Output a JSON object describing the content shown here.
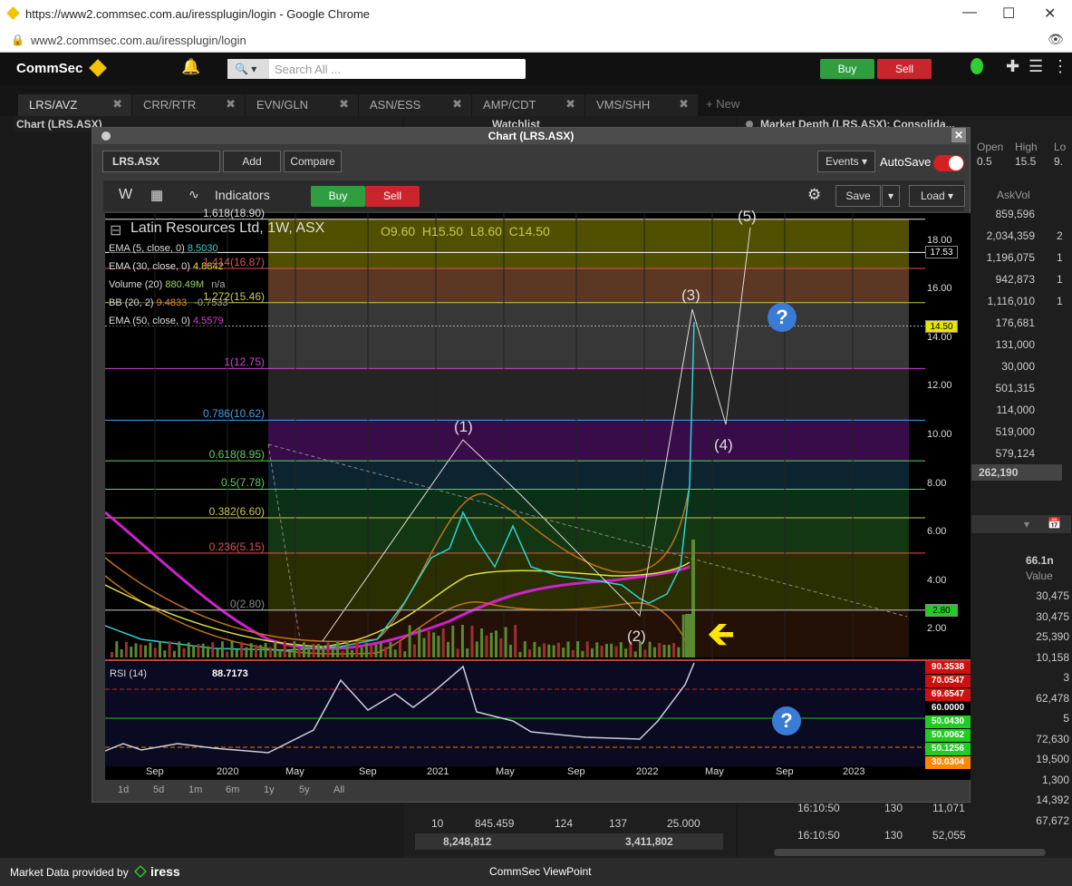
{
  "browser": {
    "title": "https://www2.commsec.com.au/iressplugin/login - Google Chrome",
    "url": "www2.commsec.com.au/iressplugin/login"
  },
  "app": {
    "logo": "CommSec",
    "search_placeholder": "Search All ...",
    "buy": "Buy",
    "sell": "Sell"
  },
  "tabs": [
    "LRS/AVZ",
    "CRR/RTR",
    "EVN/GLN",
    "ASN/ESS",
    "AMP/CDT",
    "VMS/SHH"
  ],
  "new_tab": "+ New",
  "panels": {
    "chart": "Chart (LRS.ASX)",
    "watchlist": "Watchlist",
    "depth": "Market Depth (LRS.ASX): Consolida..."
  },
  "depth": {
    "headers": [
      "Open",
      "High",
      "Lo"
    ],
    "values": [
      "0.5",
      "15.5",
      "9."
    ],
    "askvol_header": "AskVol",
    "askvols": [
      "859,596",
      "2,034,359",
      "1,196,075",
      "942,873",
      "1,116,010",
      "176,681",
      "131,000",
      "30,000",
      "501,315",
      "114,000",
      "519,000",
      "579,124"
    ],
    "right_cut": [
      "",
      "2",
      "1",
      "1",
      "1",
      "",
      "",
      "",
      "",
      "",
      "",
      ""
    ],
    "total": "262,190"
  },
  "trades": {
    "top": "66.1n",
    "value_header": "Value",
    "values": [
      "30,475",
      "30,475",
      "25,390",
      "10,158",
      "3",
      "62,478",
      "5",
      "72,630",
      "19,500",
      "1,300",
      "14,392",
      "67,672"
    ],
    "rows": [
      {
        "time": "16:10:50",
        "qty": "130",
        "price": "11,071"
      },
      {
        "time": "16:10:50",
        "qty": "130",
        "price": "52,055"
      }
    ]
  },
  "watch_bottom": {
    "row1": [
      "10",
      "845.459",
      "124",
      "137",
      "25.000"
    ],
    "row2": [
      "8,248,812",
      "3,411,802"
    ]
  },
  "modal": {
    "title": "Chart (LRS.ASX)",
    "symbol": "LRS.ASX",
    "add": "Add",
    "compare": "Compare",
    "events": "Events",
    "autosave": "AutoSave",
    "period": "W",
    "indicators": "Indicators",
    "buy": "Buy",
    "sell": "Sell",
    "save": "Save",
    "load": "Load"
  },
  "chart_data": {
    "type": "candlestick",
    "title": "Latin Resources Ltd, 1W, ASX",
    "ohlc": {
      "O": "9.60",
      "H": "15.50",
      "L": "8.60",
      "C": "14.50"
    },
    "studies": [
      {
        "name": "EMA (5, close, 0)",
        "value": "8.5030",
        "color": "#2ad4d4"
      },
      {
        "name": "EMA (30, close, 0)",
        "value": "4.8842",
        "color": "#e0e040"
      },
      {
        "name": "Volume (20)",
        "value": "880.49M",
        "extra": "n/a",
        "color": "#9bd36a"
      },
      {
        "name": "BB (20, 2)",
        "value": "9.4833",
        "extra": "-0.7533",
        "color": "#e09040"
      },
      {
        "name": "EMA (50, close, 0)",
        "value": "4.5579",
        "color": "#d040d0"
      }
    ],
    "y_ticks": [
      "18.00",
      "16.00",
      "14.00",
      "12.00",
      "10.00",
      "8.00",
      "6.00",
      "4.00",
      "2.00"
    ],
    "ylim": [
      0,
      20
    ],
    "price_badges": [
      {
        "label": "17.53",
        "value": 17.53,
        "bg": "#000",
        "fg": "#fff"
      },
      {
        "label": "14.50",
        "value": 14.5,
        "bg": "#e6e600",
        "fg": "#000"
      },
      {
        "label": "2.80",
        "value": 2.8,
        "bg": "#22cc22",
        "fg": "#000"
      }
    ],
    "fib_levels": [
      {
        "label": "1.618(18.90)",
        "value": 18.9,
        "color": "#dddddd"
      },
      {
        "label": "1.414(16.87)",
        "value": 16.87,
        "color": "#e05050"
      },
      {
        "label": "1.272(15.46)",
        "value": 15.46,
        "color": "#c8c850"
      },
      {
        "label": "1(12.75)",
        "value": 12.75,
        "color": "#d040d0"
      },
      {
        "label": "0.786(10.62)",
        "value": 10.62,
        "color": "#40a0e0"
      },
      {
        "label": "0.618(8.95)",
        "value": 8.95,
        "color": "#60d060"
      },
      {
        "label": "0.5(7.78)",
        "value": 7.78,
        "color": "#60d060"
      },
      {
        "label": "0.382(6.60)",
        "value": 6.6,
        "color": "#c8c850"
      },
      {
        "label": "0.236(5.15)",
        "value": 5.15,
        "color": "#e05050"
      },
      {
        "label": "0(2.80)",
        "value": 2.8,
        "color": "#888888"
      }
    ],
    "waves": [
      "(1)",
      "(2)",
      "(3)",
      "(4)",
      "(5)"
    ],
    "x_labels": [
      "Sep",
      "2020",
      "May",
      "Sep",
      "2021",
      "May",
      "Sep",
      "2022",
      "May",
      "Sep",
      "2023"
    ],
    "rsi": {
      "label": "RSI (14)",
      "value": "88.7173",
      "badges": [
        {
          "label": "90.3538",
          "bg": "#d01010"
        },
        {
          "label": "70.0547",
          "bg": "#d01010"
        },
        {
          "label": "69.6547",
          "bg": "#d01010"
        },
        {
          "label": "60.0000",
          "bg": "#000"
        },
        {
          "label": "50.0430",
          "bg": "#22cc22"
        },
        {
          "label": "50.0062",
          "bg": "#22cc22"
        },
        {
          "label": "50.1256",
          "bg": "#22cc22"
        },
        {
          "label": "30.0304",
          "bg": "#ff8800"
        }
      ]
    }
  },
  "ranges": [
    "1d",
    "5d",
    "1m",
    "6m",
    "1y",
    "5y",
    "All"
  ],
  "footer": {
    "provider": "Market Data provided by",
    "brand": "iress",
    "center": "CommSec ViewPoint"
  }
}
